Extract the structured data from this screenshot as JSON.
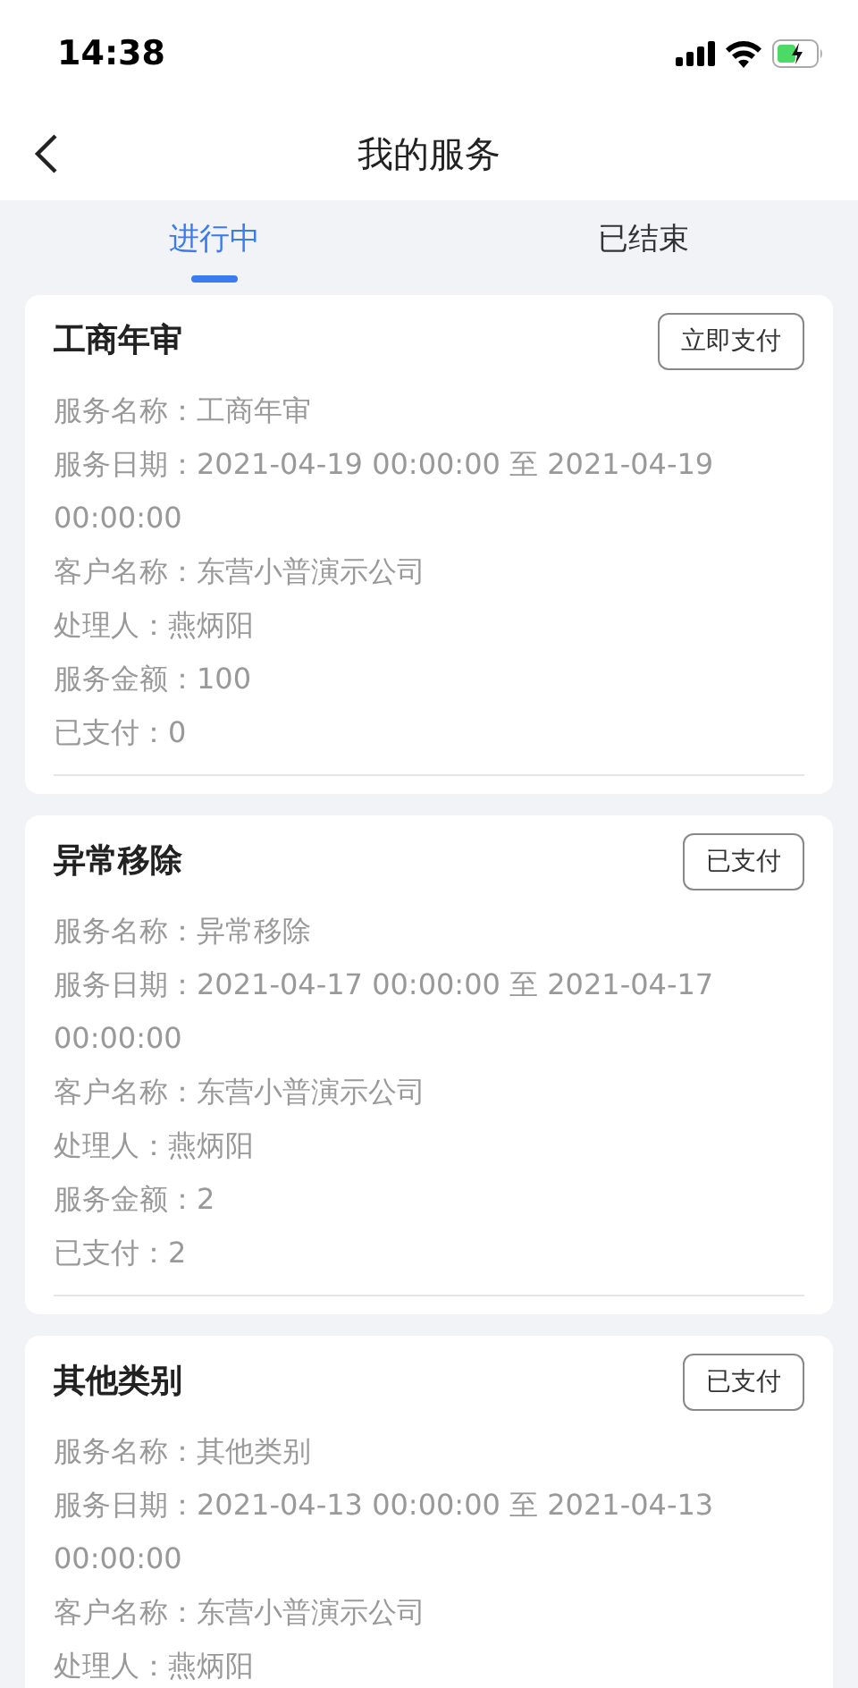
{
  "status_bar": {
    "time": "14:38"
  },
  "nav": {
    "title": "我的服务"
  },
  "tabs": [
    {
      "label": "进行中",
      "selected": true
    },
    {
      "label": "已结束",
      "selected": false
    }
  ],
  "services": [
    {
      "title": "工商年审",
      "action": "立即支付",
      "lines": [
        "服务名称：工商年审",
        "服务日期：2021-04-19 00:00:00 至 2021-04-19 00:00:00",
        "客户名称：东营小普演示公司",
        "处理人：燕炳阳",
        "服务金额：100",
        "已支付：0"
      ]
    },
    {
      "title": "异常移除",
      "action": "已支付",
      "lines": [
        "服务名称：异常移除",
        "服务日期：2021-04-17 00:00:00 至 2021-04-17 00:00:00",
        "客户名称：东营小普演示公司",
        "处理人：燕炳阳",
        "服务金额：2",
        "已支付：2"
      ]
    },
    {
      "title": "其他类别",
      "action": "已支付",
      "lines": [
        "服务名称：其他类别",
        "服务日期：2021-04-13 00:00:00 至 2021-04-13 00:00:00",
        "客户名称：东营小普演示公司",
        "处理人：燕炳阳"
      ]
    }
  ]
}
